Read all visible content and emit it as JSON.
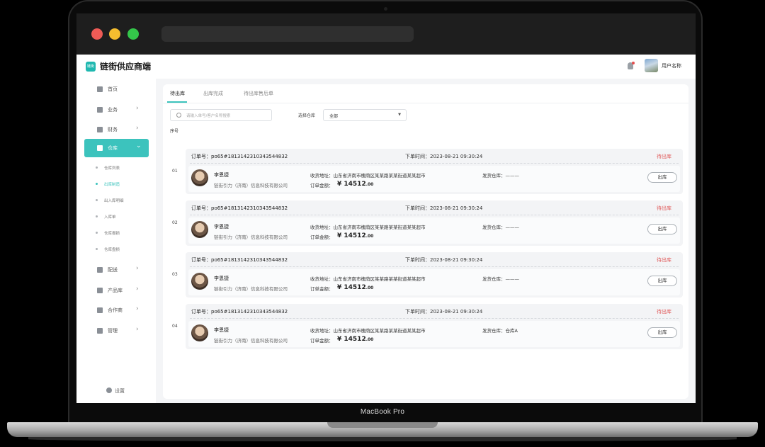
{
  "device": {
    "label": "MacBook Pro"
  },
  "app": {
    "logo_text": "链街",
    "title": "链街供应商端",
    "user_name": "用户名称"
  },
  "sidebar": {
    "items": [
      {
        "label": "首页"
      },
      {
        "label": "业务"
      },
      {
        "label": "财务"
      },
      {
        "label": "仓库"
      },
      {
        "label": "配送"
      },
      {
        "label": "产品库"
      },
      {
        "label": "合作商"
      },
      {
        "label": "管理"
      }
    ],
    "sub_items": [
      {
        "label": "仓库列表"
      },
      {
        "label": "出库制造"
      },
      {
        "label": "出入库明细"
      },
      {
        "label": "入库单"
      },
      {
        "label": "仓库报损"
      },
      {
        "label": "仓库盘损"
      }
    ],
    "settings_label": "设置"
  },
  "tabs": [
    {
      "label": "待出库"
    },
    {
      "label": "出库完成"
    },
    {
      "label": "待出库售后单"
    }
  ],
  "filters": {
    "search_placeholder": "请输入单号/客户名称搜索",
    "warehouse_label": "选择仓库",
    "warehouse_value": "全部"
  },
  "table": {
    "seq_header": "序号"
  },
  "orders": [
    {
      "seq": "01",
      "order_no": "订单号：po65#1813142310343544832",
      "time": "下单时间：2023-08-21   09:30:24",
      "status": "待出库",
      "customer": "李恩捷",
      "company": "链街引力（济南）信息科技有限公司",
      "address": "收货地址：山东省济南市槐荫区某某路某某街道某某超市",
      "amount_label": "订单金额：",
      "amount_int": "¥ 14512",
      "amount_dec": ".00",
      "warehouse": "发货仓库：———",
      "action": "出库"
    },
    {
      "seq": "02",
      "order_no": "订单号：po65#1813142310343544832",
      "time": "下单时间：2023-08-21   09:30:24",
      "status": "待出库",
      "customer": "李恩捷",
      "company": "链街引力（济南）信息科技有限公司",
      "address": "收货地址：山东省济南市槐荫区某某路某某街道某某超市",
      "amount_label": "订单金额：",
      "amount_int": "¥ 14512",
      "amount_dec": ".00",
      "warehouse": "发货仓库：———",
      "action": "出库"
    },
    {
      "seq": "03",
      "order_no": "订单号：po65#1813142310343544832",
      "time": "下单时间：2023-08-21   09:30:24",
      "status": "待出库",
      "customer": "李恩捷",
      "company": "链街引力（济南）信息科技有限公司",
      "address": "收货地址：山东省济南市槐荫区某某路某某街道某某超市",
      "amount_label": "订单金额：",
      "amount_int": "¥ 14512",
      "amount_dec": ".00",
      "warehouse": "发货仓库：———",
      "action": "出库"
    },
    {
      "seq": "04",
      "order_no": "订单号：po65#1813142310343544832",
      "time": "下单时间：2023-08-21   09:30:24",
      "status": "待出库",
      "customer": "李恩捷",
      "company": "链街引力（济南）信息科技有限公司",
      "address": "收货地址：山东省济南市槐荫区某某路某某街道某某超市",
      "amount_label": "订单金额：",
      "amount_int": "¥ 14512",
      "amount_dec": ".00",
      "warehouse": "发货仓库：仓库A",
      "action": "出库"
    }
  ]
}
